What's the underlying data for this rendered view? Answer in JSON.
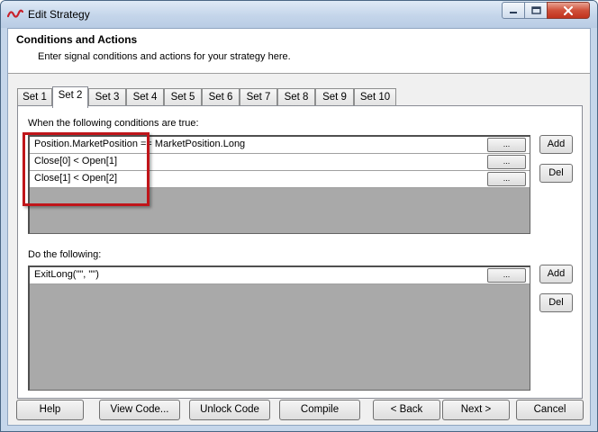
{
  "window": {
    "title": "Edit Strategy",
    "controls": [
      "minimize-icon",
      "maximize-icon",
      "close-icon"
    ]
  },
  "header": {
    "title": "Conditions and Actions",
    "subtitle": "Enter signal conditions and actions for your strategy here."
  },
  "tabs": [
    {
      "label": "Set 1",
      "active": false
    },
    {
      "label": "Set 2",
      "active": true
    },
    {
      "label": "Set 3",
      "active": false
    },
    {
      "label": "Set 4",
      "active": false
    },
    {
      "label": "Set 5",
      "active": false
    },
    {
      "label": "Set 6",
      "active": false
    },
    {
      "label": "Set 7",
      "active": false
    },
    {
      "label": "Set 8",
      "active": false
    },
    {
      "label": "Set 9",
      "active": false
    },
    {
      "label": "Set 10",
      "active": false
    }
  ],
  "conditions": {
    "label": "When the following conditions are true:",
    "rows": [
      {
        "text": "Position.MarketPosition == MarketPosition.Long",
        "button": "..."
      },
      {
        "text": "Close[0] < Open[1]",
        "button": "..."
      },
      {
        "text": "Close[1] < Open[2]",
        "button": "..."
      }
    ],
    "add_label": "Add",
    "del_label": "Del"
  },
  "actions": {
    "label": "Do the following:",
    "rows": [
      {
        "text": "ExitLong(\"\", \"\")",
        "button": "..."
      }
    ],
    "add_label": "Add",
    "del_label": "Del"
  },
  "footer": {
    "help": "Help",
    "view_code": "View Code...",
    "unlock_code": "Unlock Code",
    "compile": "Compile",
    "back": "< Back",
    "next": "Next >",
    "cancel": "Cancel"
  },
  "colors": {
    "highlight": "#c0151a",
    "grid_background": "#a9a9a9",
    "title_bar": "#c4d5ea",
    "close_button": "#c1321d"
  }
}
